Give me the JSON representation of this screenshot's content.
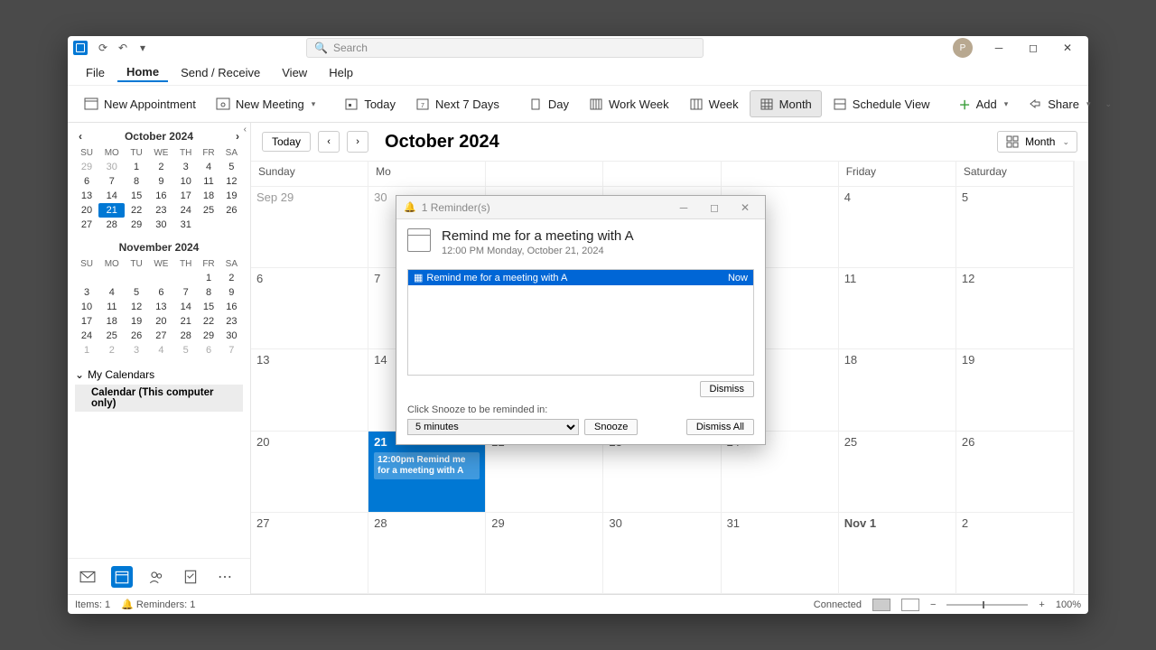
{
  "titlebar": {
    "search_placeholder": "Search",
    "avatar_initial": "P"
  },
  "menu": [
    "File",
    "Home",
    "Send / Receive",
    "View",
    "Help"
  ],
  "menu_active": 1,
  "ribbon": {
    "new_appt": "New Appointment",
    "new_meeting": "New Meeting",
    "today": "Today",
    "next7": "Next 7 Days",
    "day": "Day",
    "workweek": "Work Week",
    "week": "Week",
    "month": "Month",
    "schedule": "Schedule View",
    "add": "Add",
    "share": "Share"
  },
  "minical1": {
    "title": "October 2024",
    "dow": [
      "SU",
      "MO",
      "TU",
      "WE",
      "TH",
      "FR",
      "SA"
    ],
    "weeks": [
      [
        {
          "d": 29,
          "o": 1
        },
        {
          "d": 30,
          "o": 1
        },
        {
          "d": 1
        },
        {
          "d": 2
        },
        {
          "d": 3
        },
        {
          "d": 4
        },
        {
          "d": 5
        }
      ],
      [
        {
          "d": 6
        },
        {
          "d": 7
        },
        {
          "d": 8
        },
        {
          "d": 9
        },
        {
          "d": 10
        },
        {
          "d": 11
        },
        {
          "d": 12
        }
      ],
      [
        {
          "d": 13
        },
        {
          "d": 14
        },
        {
          "d": 15
        },
        {
          "d": 16
        },
        {
          "d": 17
        },
        {
          "d": 18
        },
        {
          "d": 19
        }
      ],
      [
        {
          "d": 20
        },
        {
          "d": 21,
          "t": 1
        },
        {
          "d": 22
        },
        {
          "d": 23
        },
        {
          "d": 24
        },
        {
          "d": 25
        },
        {
          "d": 26
        }
      ],
      [
        {
          "d": 27
        },
        {
          "d": 28
        },
        {
          "d": 29
        },
        {
          "d": 30
        },
        {
          "d": 31
        },
        {
          "d": "",
          "o": 1
        },
        {
          "d": "",
          "o": 1
        }
      ]
    ]
  },
  "minical2": {
    "title": "November 2024",
    "dow": [
      "SU",
      "MO",
      "TU",
      "WE",
      "TH",
      "FR",
      "SA"
    ],
    "weeks": [
      [
        {
          "d": "",
          "o": 1
        },
        {
          "d": "",
          "o": 1
        },
        {
          "d": "",
          "o": 1
        },
        {
          "d": "",
          "o": 1
        },
        {
          "d": "",
          "o": 1
        },
        {
          "d": 1
        },
        {
          "d": 2
        }
      ],
      [
        {
          "d": 3
        },
        {
          "d": 4
        },
        {
          "d": 5
        },
        {
          "d": 6
        },
        {
          "d": 7
        },
        {
          "d": 8
        },
        {
          "d": 9
        }
      ],
      [
        {
          "d": 10
        },
        {
          "d": 11
        },
        {
          "d": 12
        },
        {
          "d": 13
        },
        {
          "d": 14
        },
        {
          "d": 15
        },
        {
          "d": 16
        }
      ],
      [
        {
          "d": 17
        },
        {
          "d": 18
        },
        {
          "d": 19
        },
        {
          "d": 20
        },
        {
          "d": 21
        },
        {
          "d": 22
        },
        {
          "d": 23
        }
      ],
      [
        {
          "d": 24
        },
        {
          "d": 25
        },
        {
          "d": 26
        },
        {
          "d": 27
        },
        {
          "d": 28
        },
        {
          "d": 29
        },
        {
          "d": 30
        }
      ],
      [
        {
          "d": 1,
          "o": 1
        },
        {
          "d": 2,
          "o": 1
        },
        {
          "d": 3,
          "o": 1
        },
        {
          "d": 4,
          "o": 1
        },
        {
          "d": 5,
          "o": 1
        },
        {
          "d": 6,
          "o": 1
        },
        {
          "d": 7,
          "o": 1
        }
      ]
    ]
  },
  "caltree": {
    "header": "My Calendars",
    "item": "Calendar (This computer only)"
  },
  "mainhdr": {
    "today": "Today",
    "title": "October 2024",
    "viewsel": "Month"
  },
  "dayheaders": [
    "Sunday",
    "Mo",
    "",
    "",
    "",
    "Friday",
    "Saturday"
  ],
  "cells": [
    [
      {
        "l": "Sep 29",
        "o": 1
      },
      {
        "l": "30",
        "o": 1
      },
      {
        "l": ""
      },
      {
        "l": ""
      },
      {
        "l": ""
      },
      {
        "l": "4"
      },
      {
        "l": "5"
      }
    ],
    [
      {
        "l": "6"
      },
      {
        "l": "7"
      },
      {
        "l": ""
      },
      {
        "l": ""
      },
      {
        "l": ""
      },
      {
        "l": "11"
      },
      {
        "l": "12"
      }
    ],
    [
      {
        "l": "13"
      },
      {
        "l": "14"
      },
      {
        "l": ""
      },
      {
        "l": ""
      },
      {
        "l": ""
      },
      {
        "l": "18"
      },
      {
        "l": "19"
      }
    ],
    [
      {
        "l": "20"
      },
      {
        "l": "21",
        "today": 1,
        "ev": "12:00pm Remind me for a meeting with A"
      },
      {
        "l": "22"
      },
      {
        "l": "23"
      },
      {
        "l": "24"
      },
      {
        "l": "25"
      },
      {
        "l": "26"
      }
    ],
    [
      {
        "l": "27"
      },
      {
        "l": "28"
      },
      {
        "l": "29"
      },
      {
        "l": "30"
      },
      {
        "l": "31"
      },
      {
        "l": "Nov 1",
        "bold": 1
      },
      {
        "l": "2"
      }
    ]
  ],
  "dialog": {
    "title": "1 Reminder(s)",
    "subject": "Remind me for a meeting with A",
    "datetime": "12:00 PM Monday, October 21, 2024",
    "row_name": "Remind me for a meeting with A",
    "row_due": "Now",
    "dismiss": "Dismiss",
    "snooze_label": "Click Snooze to be reminded in:",
    "snooze_value": "5 minutes",
    "snooze_btn": "Snooze",
    "dismiss_all": "Dismiss All"
  },
  "status": {
    "items": "Items: 1",
    "reminders": "Reminders: 1",
    "connected": "Connected",
    "zoom": "100%"
  }
}
